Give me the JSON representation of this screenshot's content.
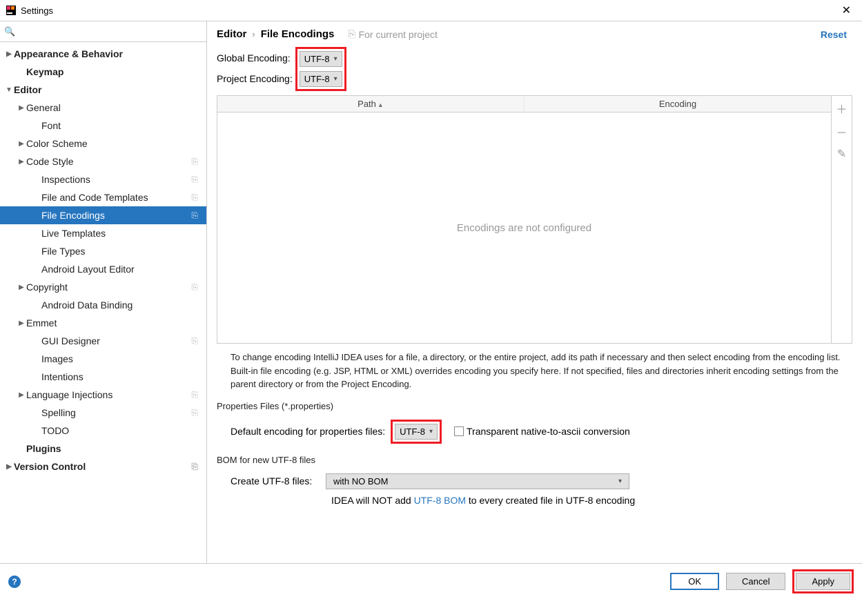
{
  "window": {
    "title": "Settings"
  },
  "sidebar": {
    "search_placeholder": "",
    "items": [
      {
        "label": "Appearance & Behavior",
        "level": 0,
        "bold": true,
        "arrow": "right",
        "selected": false,
        "badge": ""
      },
      {
        "label": "Keymap",
        "level": 1,
        "bold": true,
        "arrow": "",
        "selected": false,
        "badge": ""
      },
      {
        "label": "Editor",
        "level": 0,
        "bold": true,
        "arrow": "down",
        "selected": false,
        "badge": ""
      },
      {
        "label": "General",
        "level": 1,
        "bold": false,
        "arrow": "right",
        "selected": false,
        "badge": ""
      },
      {
        "label": "Font",
        "level": 2,
        "bold": false,
        "arrow": "",
        "selected": false,
        "badge": ""
      },
      {
        "label": "Color Scheme",
        "level": 1,
        "bold": false,
        "arrow": "right",
        "selected": false,
        "badge": ""
      },
      {
        "label": "Code Style",
        "level": 1,
        "bold": false,
        "arrow": "right",
        "selected": false,
        "badge": "⎘"
      },
      {
        "label": "Inspections",
        "level": 2,
        "bold": false,
        "arrow": "",
        "selected": false,
        "badge": "⎘"
      },
      {
        "label": "File and Code Templates",
        "level": 2,
        "bold": false,
        "arrow": "",
        "selected": false,
        "badge": "⎘"
      },
      {
        "label": "File Encodings",
        "level": 2,
        "bold": false,
        "arrow": "",
        "selected": true,
        "badge": "⎘"
      },
      {
        "label": "Live Templates",
        "level": 2,
        "bold": false,
        "arrow": "",
        "selected": false,
        "badge": ""
      },
      {
        "label": "File Types",
        "level": 2,
        "bold": false,
        "arrow": "",
        "selected": false,
        "badge": ""
      },
      {
        "label": "Android Layout Editor",
        "level": 2,
        "bold": false,
        "arrow": "",
        "selected": false,
        "badge": ""
      },
      {
        "label": "Copyright",
        "level": 1,
        "bold": false,
        "arrow": "right",
        "selected": false,
        "badge": "⎘"
      },
      {
        "label": "Android Data Binding",
        "level": 2,
        "bold": false,
        "arrow": "",
        "selected": false,
        "badge": ""
      },
      {
        "label": "Emmet",
        "level": 1,
        "bold": false,
        "arrow": "right",
        "selected": false,
        "badge": ""
      },
      {
        "label": "GUI Designer",
        "level": 2,
        "bold": false,
        "arrow": "",
        "selected": false,
        "badge": "⎘"
      },
      {
        "label": "Images",
        "level": 2,
        "bold": false,
        "arrow": "",
        "selected": false,
        "badge": ""
      },
      {
        "label": "Intentions",
        "level": 2,
        "bold": false,
        "arrow": "",
        "selected": false,
        "badge": ""
      },
      {
        "label": "Language Injections",
        "level": 1,
        "bold": false,
        "arrow": "right",
        "selected": false,
        "badge": "⎘"
      },
      {
        "label": "Spelling",
        "level": 2,
        "bold": false,
        "arrow": "",
        "selected": false,
        "badge": "⎘"
      },
      {
        "label": "TODO",
        "level": 2,
        "bold": false,
        "arrow": "",
        "selected": false,
        "badge": ""
      },
      {
        "label": "Plugins",
        "level": 1,
        "bold": true,
        "arrow": "",
        "selected": false,
        "badge": ""
      },
      {
        "label": "Version Control",
        "level": 0,
        "bold": true,
        "arrow": "right",
        "selected": false,
        "badge": "⎘"
      }
    ]
  },
  "breadcrumb": {
    "part1": "Editor",
    "part2": "File Encodings",
    "for_project": "For current project",
    "reset": "Reset"
  },
  "encoding": {
    "global_label": "Global Encoding:",
    "global_value": "UTF-8",
    "project_label": "Project Encoding:",
    "project_value": "UTF-8"
  },
  "table": {
    "col_path": "Path",
    "col_encoding": "Encoding",
    "empty_msg": "Encodings are not configured"
  },
  "help_text": "To change encoding IntelliJ IDEA uses for a file, a directory, or the entire project, add its path if necessary and then select encoding from the encoding list. Built-in file encoding (e.g. JSP, HTML or XML) overrides encoding you specify here. If not specified, files and directories inherit encoding settings from the parent directory or from the Project Encoding.",
  "properties": {
    "section_label": "Properties Files (*.properties)",
    "default_label": "Default encoding for properties files:",
    "default_value": "UTF-8",
    "transparent_label": "Transparent native-to-ascii conversion"
  },
  "bom": {
    "section_label": "BOM for new UTF-8 files",
    "create_label": "Create UTF-8 files:",
    "create_value": "with NO BOM",
    "note_prefix": "IDEA will NOT add ",
    "note_link": "UTF-8 BOM",
    "note_suffix": " to every created file in UTF-8 encoding"
  },
  "buttons": {
    "ok": "OK",
    "cancel": "Cancel",
    "apply": "Apply"
  }
}
